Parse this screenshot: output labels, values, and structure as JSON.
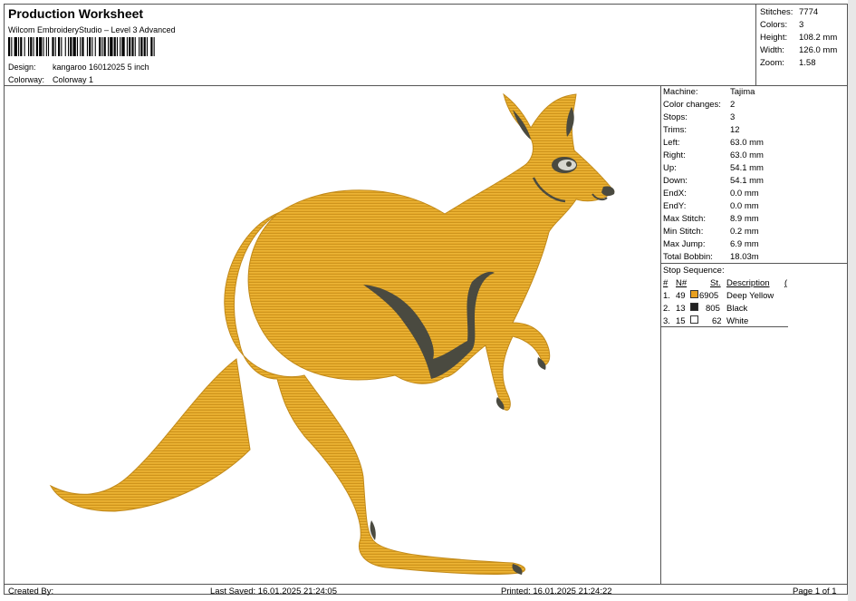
{
  "header": {
    "title": "Production Worksheet",
    "software": "Wilcom EmbroideryStudio – Level 3 Advanced",
    "design_label": "Design:",
    "design_value": "kangaroo 16012025 5 inch",
    "colorway_label": "Colorway:",
    "colorway_value": "Colorway 1"
  },
  "stats": [
    {
      "label": "Stitches:",
      "value": "7774"
    },
    {
      "label": "Colors:",
      "value": "3"
    },
    {
      "label": "Height:",
      "value": "108.2 mm"
    },
    {
      "label": "Width:",
      "value": "126.0 mm"
    },
    {
      "label": "Zoom:",
      "value": "1.58"
    }
  ],
  "machine_info": [
    {
      "label": "Machine:",
      "value": "Tajima"
    },
    {
      "label": "Color changes:",
      "value": "2"
    },
    {
      "label": "Stops:",
      "value": "3"
    },
    {
      "label": "Trims:",
      "value": "12"
    },
    {
      "label": "Left:",
      "value": "63.0 mm"
    },
    {
      "label": "Right:",
      "value": "63.0 mm"
    },
    {
      "label": "Up:",
      "value": "54.1 mm"
    },
    {
      "label": "Down:",
      "value": "54.1 mm"
    },
    {
      "label": "EndX:",
      "value": "0.0 mm"
    },
    {
      "label": "EndY:",
      "value": "0.0 mm"
    },
    {
      "label": "Max Stitch:",
      "value": "8.9 mm"
    },
    {
      "label": "Min Stitch:",
      "value": "0.2 mm"
    },
    {
      "label": "Max Jump:",
      "value": "6.9 mm"
    },
    {
      "label": "Total Bobbin:",
      "value": "18.03m"
    }
  ],
  "stop_sequence": {
    "title": "Stop Sequence:",
    "headers": {
      "num": "#",
      "n": "N#",
      "st": "St.",
      "desc": "Description",
      "extra": "("
    },
    "rows": [
      {
        "index": "1.",
        "n": "49",
        "color": "#e8a020",
        "st": "6905",
        "desc": "Deep Yellow"
      },
      {
        "index": "2.",
        "n": "13",
        "color": "#222222",
        "st": "805",
        "desc": "Black"
      },
      {
        "index": "3.",
        "n": "15",
        "color": "#ffffff",
        "st": "62",
        "desc": "White"
      }
    ]
  },
  "footer": {
    "created_by": "Created By:",
    "last_saved": "Last Saved: 16.01.2025 21:24:05",
    "printed": "Printed: 16.01.2025 21:24:22",
    "page": "Page 1 of 1"
  }
}
